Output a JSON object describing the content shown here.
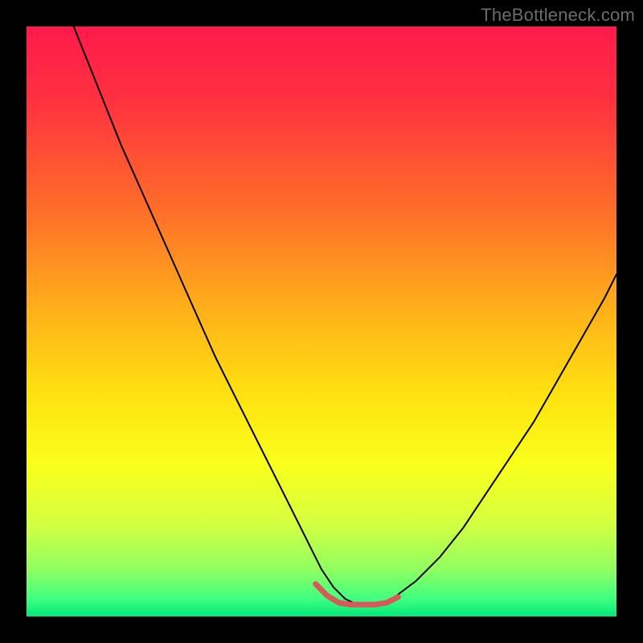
{
  "watermark": "TheBottleneck.com",
  "chart_data": {
    "type": "line",
    "title": "",
    "xlabel": "",
    "ylabel": "",
    "xlim": [
      0,
      100
    ],
    "ylim": [
      0,
      100
    ],
    "grid": false,
    "legend": false,
    "annotations": [],
    "background_gradient_stops": [
      {
        "offset": 0.0,
        "color": "#ff1a4b"
      },
      {
        "offset": 0.12,
        "color": "#ff3040"
      },
      {
        "offset": 0.3,
        "color": "#ff6a2a"
      },
      {
        "offset": 0.48,
        "color": "#ffb01a"
      },
      {
        "offset": 0.62,
        "color": "#ffe010"
      },
      {
        "offset": 0.74,
        "color": "#faff1a"
      },
      {
        "offset": 0.84,
        "color": "#d6ff40"
      },
      {
        "offset": 0.92,
        "color": "#90ff60"
      },
      {
        "offset": 0.97,
        "color": "#40ff80"
      },
      {
        "offset": 1.0,
        "color": "#00e878"
      }
    ],
    "series": [
      {
        "name": "bottleneck-curve",
        "color": "#000000",
        "width": 2,
        "x": [
          8.0,
          12.0,
          16.0,
          20.0,
          24.0,
          28.0,
          32.0,
          36.0,
          40.0,
          44.0,
          48.0,
          50.0,
          52.0,
          54.0,
          56.0,
          58.0,
          60.0,
          62.0,
          66.0,
          70.0,
          74.0,
          78.0,
          82.0,
          86.0,
          90.0,
          94.0,
          98.0,
          100.0
        ],
        "y": [
          100.0,
          90.0,
          80.0,
          71.0,
          62.0,
          53.0,
          44.0,
          36.0,
          28.0,
          20.0,
          12.0,
          8.0,
          5.0,
          3.0,
          2.0,
          2.0,
          2.0,
          3.0,
          6.0,
          10.0,
          15.0,
          21.0,
          27.0,
          33.0,
          40.0,
          47.0,
          54.0,
          58.0
        ]
      },
      {
        "name": "optimal-band",
        "color": "#d65a5a",
        "width": 7,
        "x": [
          49.0,
          51.0,
          53.0,
          55.0,
          57.0,
          59.0,
          61.0,
          63.0
        ],
        "y": [
          5.5,
          3.5,
          2.3,
          2.0,
          2.0,
          2.0,
          2.3,
          3.3
        ]
      }
    ]
  }
}
